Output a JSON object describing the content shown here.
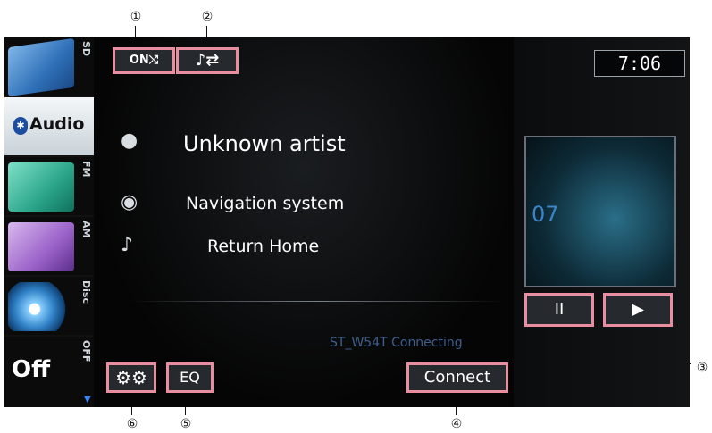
{
  "callouts": {
    "c1": "①",
    "c2": "②",
    "c3": "③",
    "c4": "④",
    "c5": "⑤",
    "c6": "⑥"
  },
  "sources": [
    {
      "label": "SD"
    },
    {
      "label": "Audio"
    },
    {
      "label": "FM"
    },
    {
      "label": "AM"
    },
    {
      "label": "Disc"
    },
    {
      "label": "OFF",
      "art_text": "Off"
    }
  ],
  "top_buttons": {
    "random_label": "ON⤭",
    "repeat_label": "♪⇄"
  },
  "track_info": {
    "artist": "Unknown artist",
    "album": "Navigation system",
    "title": "Return Home"
  },
  "status_text": "ST_W54T Connecting",
  "bottom_buttons": {
    "settings_icon": "gear-icon",
    "eq_label": "EQ",
    "connect_label": "Connect"
  },
  "clock": "7:06",
  "track_number": "07",
  "controls": {
    "pause_label": "II",
    "play_label": "▶"
  },
  "colors": {
    "callout_border": "#e98ea0",
    "track_number": "#3c84c8",
    "status": "#3d5e8c"
  }
}
